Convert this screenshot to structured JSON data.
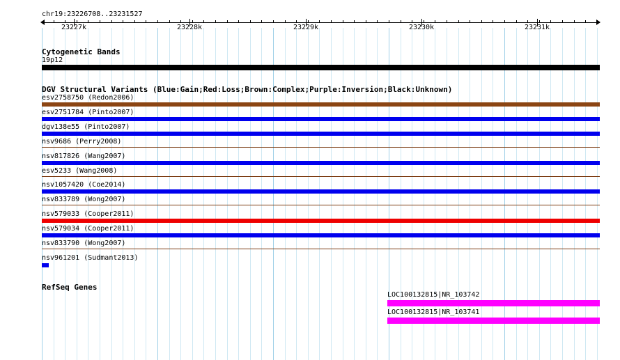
{
  "ruler": {
    "location": "chr19:23226708..23231527",
    "tick_labels": [
      "23227k",
      "23228k",
      "23229k",
      "23230k",
      "23231k"
    ]
  },
  "cytoband_track": {
    "title": "Cytogenetic Bands",
    "band_label": "19p12",
    "band_color": "#000000"
  },
  "dgv_track": {
    "title": "DGV Structural Variants (Blue:Gain;Red:Loss;Brown:Complex;Purple:Inversion;Black:Unknown)",
    "colors": {
      "gain": "#0000ee",
      "loss": "#ee0000",
      "complex": "#8b4513",
      "neutral_line": "#8b2500"
    },
    "features": [
      {
        "label": "esv2758750 (Redon2006)",
        "type": "complex"
      },
      {
        "label": "esv2751784 (Pinto2007)",
        "type": "gain"
      },
      {
        "label": "dgv138e55 (Pinto2007)",
        "type": "gain"
      },
      {
        "label": "nsv9686 (Perry2008)",
        "type": "line"
      },
      {
        "label": "nsv817826 (Wang2007)",
        "type": "gain"
      },
      {
        "label": "esv5233 (Wang2008)",
        "type": "line"
      },
      {
        "label": "nsv1057420 (Coe2014)",
        "type": "gain"
      },
      {
        "label": "nsv833789 (Wong2007)",
        "type": "line"
      },
      {
        "label": "nsv579033 (Cooper2011)",
        "type": "loss"
      },
      {
        "label": "nsv579034 (Cooper2011)",
        "type": "gain"
      },
      {
        "label": "nsv833790 (Wong2007)",
        "type": "line"
      },
      {
        "label": "nsv961201 (Sudmant2013)",
        "type": "small-gain"
      }
    ]
  },
  "refseq_track": {
    "title": "RefSeq Genes",
    "color": "#ff00ff",
    "genes": [
      {
        "label": "LOC100132815|NR_103742"
      },
      {
        "label": "LOC100132815|NR_103741"
      }
    ]
  }
}
